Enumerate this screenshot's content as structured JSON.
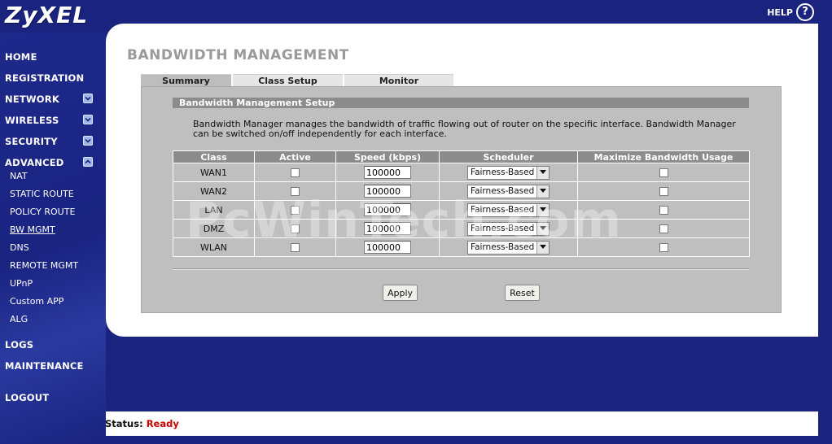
{
  "app": {
    "logo": "ZyXEL",
    "help_label": "HELP",
    "help_icon": "question-circle-icon"
  },
  "nav": {
    "main": [
      {
        "label": "HOME"
      },
      {
        "label": "REGISTRATION"
      },
      {
        "label": "NETWORK",
        "expand": "chevron-down"
      },
      {
        "label": "WIRELESS",
        "expand": "chevron-down"
      },
      {
        "label": "SECURITY",
        "expand": "chevron-down"
      },
      {
        "label": "ADVANCED",
        "expand": "chevron-up"
      }
    ],
    "sub": [
      "NAT",
      "STATIC ROUTE",
      "POLICY ROUTE",
      "BW MGMT",
      "DNS",
      "REMOTE MGMT",
      "UPnP",
      "Custom APP",
      "ALG"
    ],
    "bottom": [
      "LOGS",
      "MAINTENANCE",
      "LOGOUT"
    ],
    "active_sub": "BW MGMT"
  },
  "page": {
    "title": "BANDWIDTH MANAGEMENT",
    "tabs": [
      "Summary",
      "Class Setup",
      "Monitor"
    ],
    "active_tab": "Summary",
    "section_header": "Bandwidth Management Setup",
    "description": "Bandwidth Manager manages the bandwidth of traffic flowing out of router on the specific interface. Bandwidth Manager can be switched on/off independently for each interface."
  },
  "table": {
    "headers": [
      "Class",
      "Active",
      "Speed (kbps)",
      "Scheduler",
      "Maximize Bandwidth Usage"
    ],
    "rows": [
      {
        "class": "WAN1",
        "active": false,
        "speed": "100000",
        "scheduler": "Fairness-Based",
        "maximize": false
      },
      {
        "class": "WAN2",
        "active": false,
        "speed": "100000",
        "scheduler": "Fairness-Based",
        "maximize": false
      },
      {
        "class": "LAN",
        "active": false,
        "speed": "100000",
        "scheduler": "Fairness-Based",
        "maximize": false
      },
      {
        "class": "DMZ",
        "active": false,
        "speed": "100000",
        "scheduler": "Fairness-Based",
        "maximize": false
      },
      {
        "class": "WLAN",
        "active": false,
        "speed": "100000",
        "scheduler": "Fairness-Based",
        "maximize": false
      }
    ]
  },
  "buttons": {
    "apply": "Apply",
    "reset": "Reset"
  },
  "status": {
    "label": "Status:",
    "value": "Ready"
  },
  "watermark": "PcWinTech.com",
  "colors": {
    "background": "#1a237e",
    "status_ready": "#cc0000",
    "header_gray": "#8c8c8c",
    "panel_gray": "#bfbfbf"
  }
}
